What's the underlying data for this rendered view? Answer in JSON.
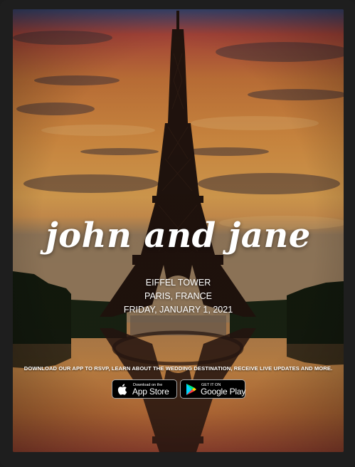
{
  "invite": {
    "couple": "john and jane",
    "venue": "EIFFEL TOWER",
    "location": "PARIS, FRANCE",
    "date": "FRIDAY, JANUARY 1, 2021",
    "app_promo": "DOWNLOAD OUR APP TO RSVP, LEARN ABOUT THE WEDDING DESTINATION, RECEIVE LIVE UPDATES AND MORE."
  },
  "stores": {
    "apple": {
      "small": "Download on the",
      "big": "App Store",
      "icon": "apple-logo-icon"
    },
    "google": {
      "small": "GET IT ON",
      "big": "Google Play",
      "icon": "google-play-icon"
    }
  },
  "colors": {
    "sky_top": "#3a4f7a",
    "sky_glow": "#f0a04a",
    "tower": "#241510",
    "trees": "#16200e",
    "water": "#9a6a44"
  }
}
